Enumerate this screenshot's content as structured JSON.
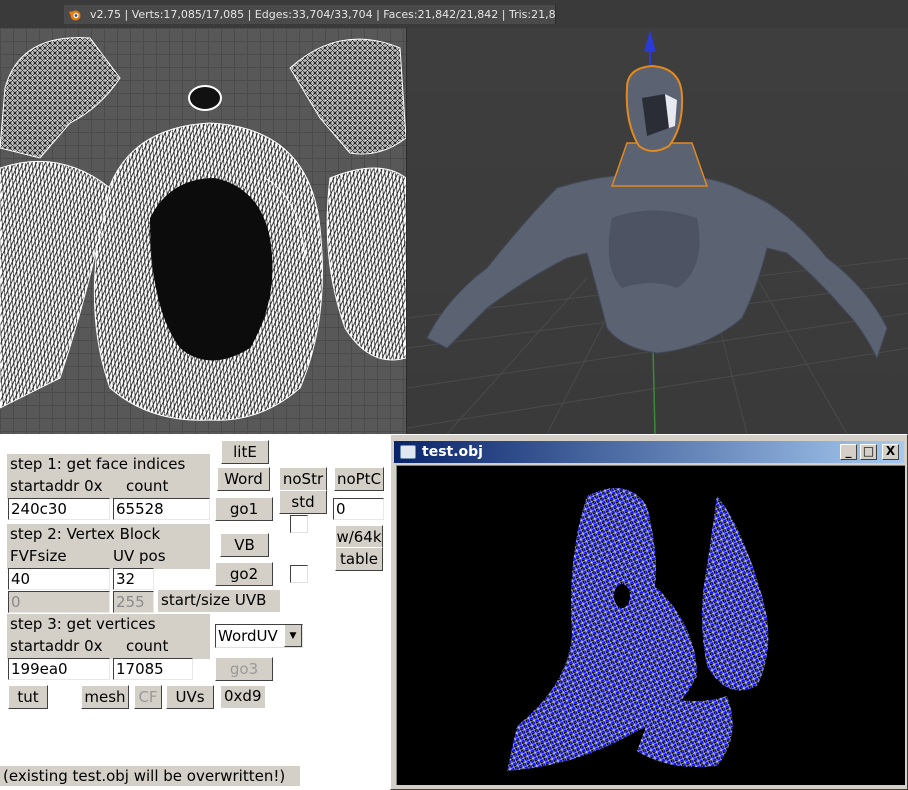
{
  "infobar": {
    "stats": "v2.75 | Verts:17,085/17,085 | Edges:33,704/33,704 | Faces:21,842/21,842 | Tris:21,842 |",
    "logo_icon": "blender-logo-icon"
  },
  "uv_editor": {
    "icon": "uv-mesh-icon"
  },
  "viewport": {
    "icon": "3d-figure-icon",
    "accent": "#e08a20"
  },
  "tool_panel": {
    "step1": {
      "title": "step 1: get face indices",
      "addr_label": "startaddr 0x",
      "count_label": "count",
      "addr_value": "240c30",
      "count_value": "65528"
    },
    "step2": {
      "title": "step 2: Vertex Block",
      "fvf_label": "FVFsize",
      "uvpos_label": "UV pos",
      "fvf_value": "40",
      "uvpos_value": "32",
      "uvb_start": "0",
      "uvb_size": "255",
      "uvb_label": "start/size UVB"
    },
    "step3": {
      "title": "step 3: get vertices",
      "addr_label": "startaddr 0x",
      "count_label": "count",
      "addr_value": "199ea0",
      "count_value": "17085"
    },
    "buttons": {
      "lite": "litE",
      "word": "Word",
      "go1": "go1",
      "nostr": "noStr",
      "noptc": "noPtC",
      "std": "std",
      "ptc_value": "0",
      "vb": "VB",
      "w64k": "w/64k",
      "table": "table",
      "go2": "go2",
      "go3": "go3",
      "tut": "tut",
      "mesh": "mesh",
      "cf": "CF",
      "uvs": "UVs",
      "hex": "0xd9"
    },
    "uv_type": {
      "selected": "WordUV"
    },
    "note": "(existing test.obj will be overwritten!)"
  },
  "obj_window": {
    "title": "test.obj",
    "minimize": "_",
    "maximize": "□",
    "close": "X",
    "mesh_color": "#0a0aff"
  }
}
